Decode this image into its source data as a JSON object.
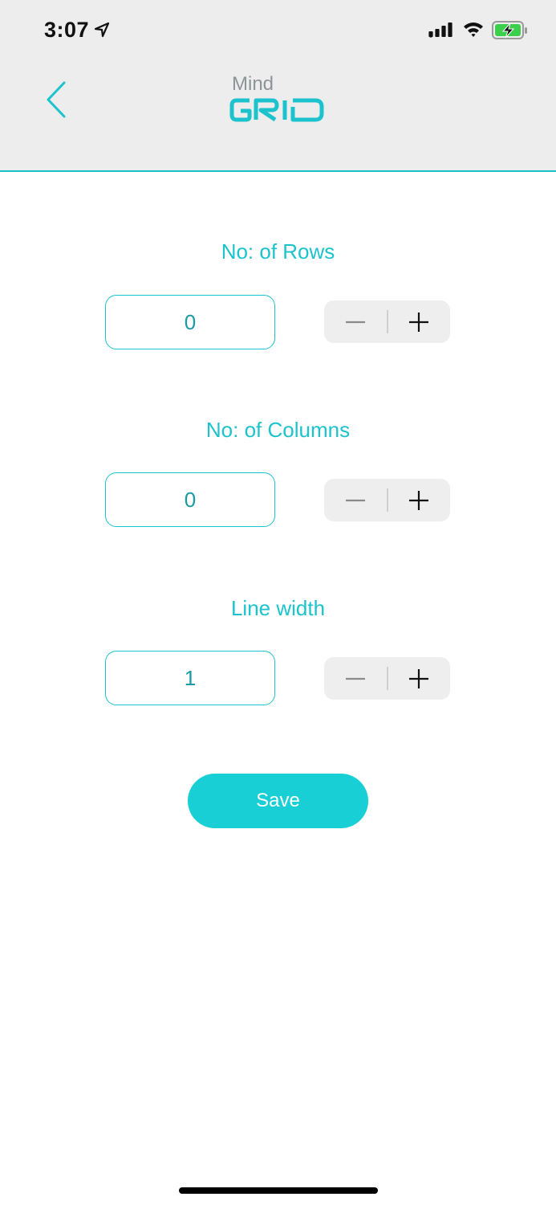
{
  "status_bar": {
    "time": "3:07",
    "icons": [
      "location-arrow-icon",
      "signal-icon",
      "wifi-icon",
      "battery-charging-icon"
    ]
  },
  "header": {
    "back_icon": "chevron-left-icon",
    "logo_top": "Mind",
    "logo_bottom": "GRID"
  },
  "settings": [
    {
      "label": "No: of Rows",
      "value": "0",
      "minus": "−",
      "plus": "+"
    },
    {
      "label": "No: of Columns",
      "value": "0",
      "minus": "−",
      "plus": "+"
    },
    {
      "label": "Line width",
      "value": "1",
      "minus": "−",
      "plus": "+"
    }
  ],
  "save_label": "Save",
  "colors": {
    "accent": "#1cc3cd",
    "button": "#18cfd6",
    "header_bg": "#ededed",
    "stepper_bg": "#eeeeee"
  }
}
